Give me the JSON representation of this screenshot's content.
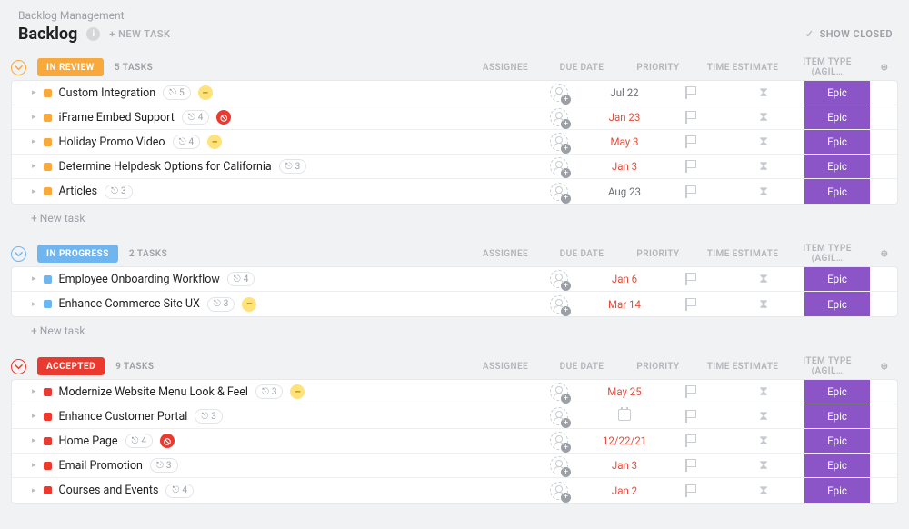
{
  "breadcrumb": "Backlog Management",
  "title": "Backlog",
  "newTaskTop": "+ NEW TASK",
  "showClosed": "SHOW CLOSED",
  "columns": {
    "assignee": "ASSIGNEE",
    "due": "DUE DATE",
    "priority": "PRIORITY",
    "time": "TIME ESTIMATE",
    "type": "ITEM TYPE (AGIL…"
  },
  "typeValue": "Epic",
  "newTaskLabel": "+ New task",
  "sections": [
    {
      "badge": "IN REVIEW",
      "color": "orange",
      "count": "5 TASKS",
      "rows": [
        {
          "title": "Custom Integration",
          "sub": "5",
          "chip": "yellow",
          "due": "Jul 22",
          "dueRed": false
        },
        {
          "title": "iFrame Embed Support",
          "sub": "4",
          "chip": "red",
          "due": "Jan 23",
          "dueRed": true
        },
        {
          "title": "Holiday Promo Video",
          "sub": "4",
          "chip": "yellow",
          "due": "May 3",
          "dueRed": true
        },
        {
          "title": "Determine Helpdesk Options for California",
          "sub": "3",
          "chip": "",
          "due": "Jan 3",
          "dueRed": true
        },
        {
          "title": "Articles",
          "sub": "3",
          "chip": "",
          "due": "Aug 23",
          "dueRed": false
        }
      ]
    },
    {
      "badge": "IN PROGRESS",
      "color": "blue",
      "count": "2 TASKS",
      "rows": [
        {
          "title": "Employee Onboarding Workflow",
          "sub": "4",
          "chip": "",
          "due": "Jan 6",
          "dueRed": true
        },
        {
          "title": "Enhance Commerce Site UX",
          "sub": "3",
          "chip": "yellow",
          "due": "Mar 14",
          "dueRed": true
        }
      ]
    },
    {
      "badge": "ACCEPTED",
      "color": "red",
      "count": "9 TASKS",
      "rows": [
        {
          "title": "Modernize Website Menu Look & Feel",
          "sub": "3",
          "chip": "yellow",
          "due": "May 25",
          "dueRed": true
        },
        {
          "title": "Enhance Customer Portal",
          "sub": "3",
          "chip": "",
          "due": "CAL",
          "dueRed": false
        },
        {
          "title": "Home Page",
          "sub": "4",
          "chip": "red",
          "due": "12/22/21",
          "dueRed": true
        },
        {
          "title": "Email Promotion",
          "sub": "3",
          "chip": "",
          "due": "Jan 3",
          "dueRed": true
        },
        {
          "title": "Courses and Events",
          "sub": "4",
          "chip": "",
          "due": "Jan 2",
          "dueRed": true
        }
      ]
    }
  ]
}
